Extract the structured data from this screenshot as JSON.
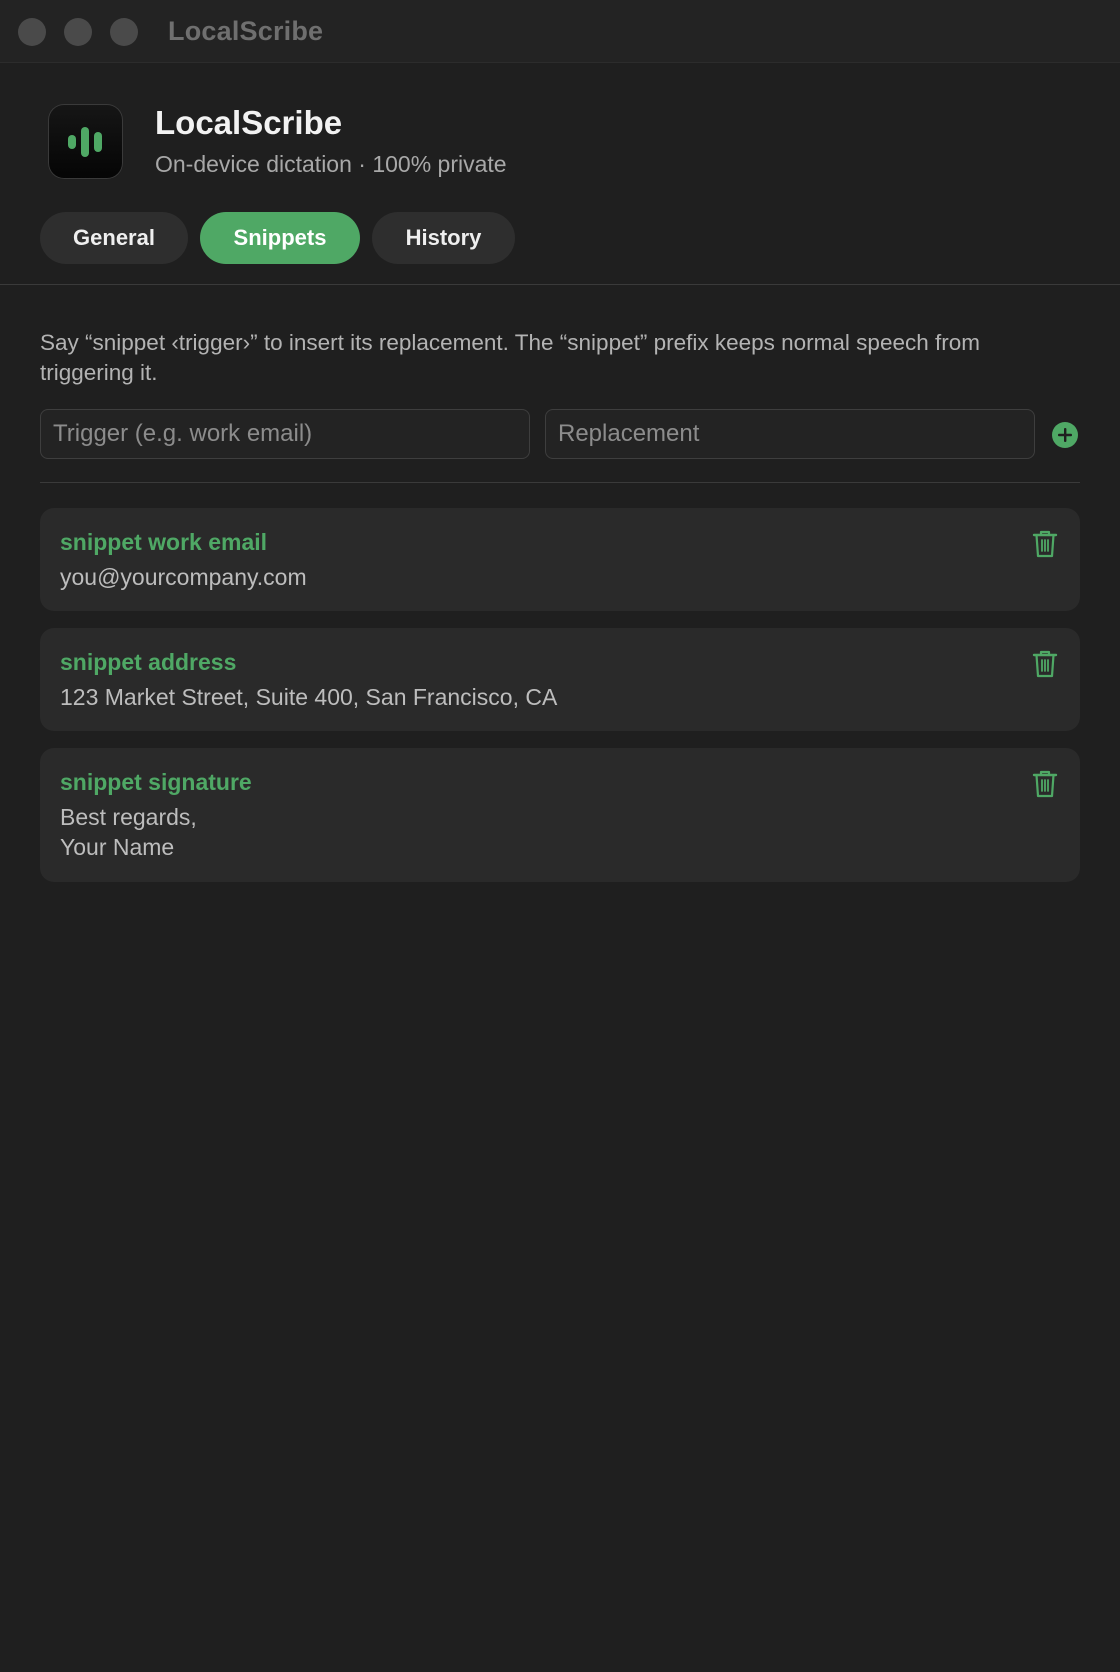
{
  "window": {
    "title": "LocalScribe"
  },
  "app": {
    "name": "LocalScribe",
    "subtitle": "On-device dictation · 100% private",
    "icon": "waveform-icon"
  },
  "tabs": [
    {
      "label": "General",
      "active": false
    },
    {
      "label": "Snippets",
      "active": true
    },
    {
      "label": "History",
      "active": false
    }
  ],
  "snippets_page": {
    "help_text": "Say “snippet ‹trigger›” to insert its replacement. The “snippet” prefix keeps normal speech from triggering it.",
    "trigger_input": {
      "value": "",
      "placeholder": "Trigger (e.g. work email)"
    },
    "replacement_input": {
      "value": "",
      "placeholder": "Replacement"
    },
    "add_icon": "plus-circle-icon",
    "items": [
      {
        "trigger": "snippet work email",
        "replacement": "you@yourcompany.com",
        "delete_icon": "trash-icon"
      },
      {
        "trigger": "snippet address",
        "replacement": "123 Market Street, Suite 400, San Francisco, CA",
        "delete_icon": "trash-icon"
      },
      {
        "trigger": "snippet signature",
        "replacement": "Best regards,\nYour Name",
        "delete_icon": "trash-icon"
      }
    ]
  },
  "colors": {
    "accent": "#4fa865",
    "background": "#1f1f1f",
    "card": "#2a2a2a"
  }
}
